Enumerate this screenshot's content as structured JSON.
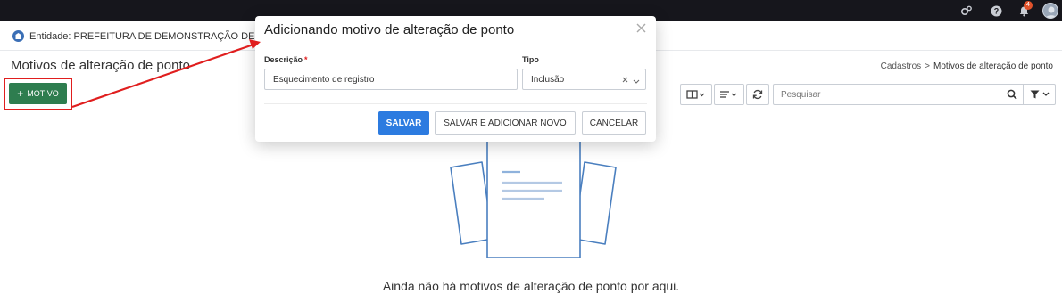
{
  "topbar": {
    "icons": [
      "gears-icon",
      "help-icon",
      "bell-icon",
      "avatar"
    ],
    "notification_count": "4"
  },
  "page": {
    "entity_label": "Entidade: PREFEITURA DE DEMONSTRAÇÃO DE EDI",
    "title": "Motivos de alteração de ponto",
    "breadcrumb": {
      "parent": "Cadastros",
      "separator": ">",
      "current": "Motivos de alteração de ponto"
    },
    "add_button_label": "MOTIVO",
    "search_placeholder": "Pesquisar",
    "empty_message": "Ainda não há motivos de alteração de ponto por aqui."
  },
  "modal": {
    "title": "Adicionando motivo de alteração de ponto",
    "description_label": "Descrição",
    "description_required_mark": "*",
    "description_value": "Esquecimento de registro",
    "type_label": "Tipo",
    "type_value": "Inclusão",
    "save_label": "SALVAR",
    "save_and_new_label": "SALVAR E ADICIONAR NOVO",
    "cancel_label": "CANCELAR"
  },
  "colors": {
    "topbar_bg": "#16161c",
    "primary": "#2c7be0",
    "add_button": "#2e7d4f",
    "annotation_red": "#e01e1e",
    "illustration_stroke": "#4a7fbf"
  }
}
